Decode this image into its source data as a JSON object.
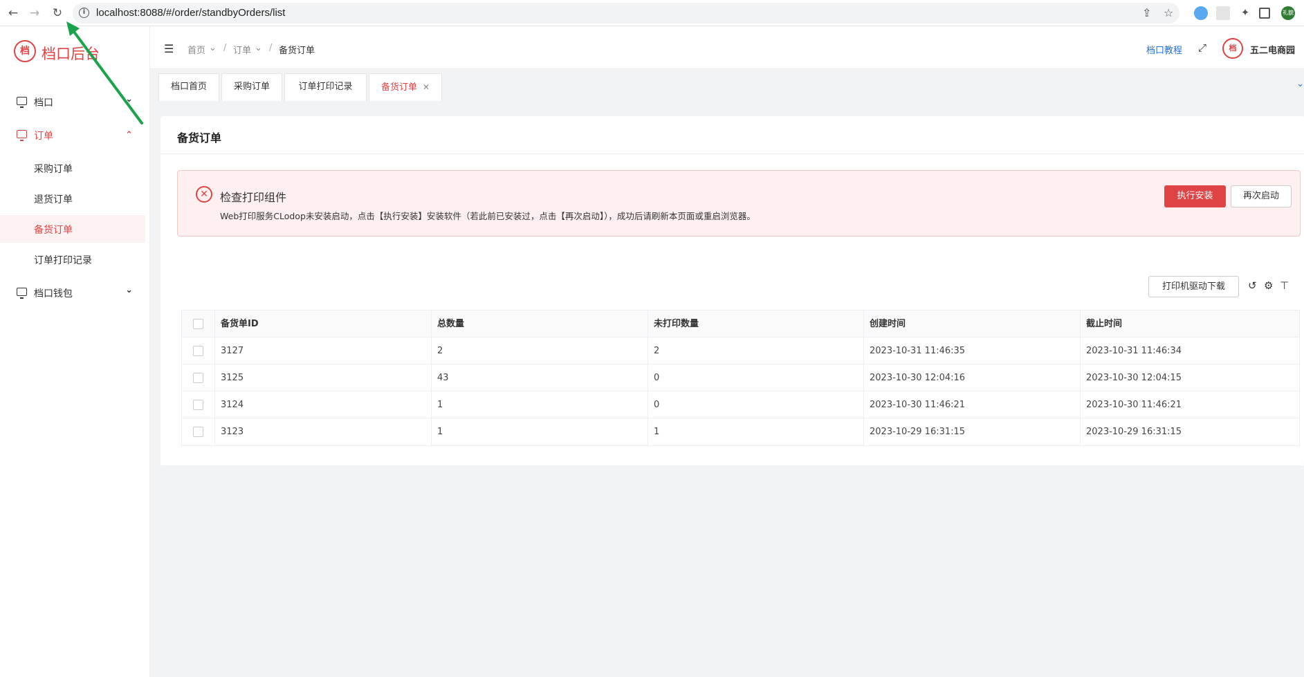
{
  "browser": {
    "url": "localhost:8088/#/order/standbyOrders/list",
    "profile_badge": "礼貌"
  },
  "sidebar": {
    "logo_text": "档口后台",
    "items": [
      {
        "label": "档口",
        "icon": "monitor-icon",
        "expanded": false
      },
      {
        "label": "订单",
        "icon": "monitor-icon",
        "expanded": true,
        "active": true
      },
      {
        "label": "档口钱包",
        "icon": "monitor-icon",
        "expanded": false
      }
    ],
    "sub_items": [
      {
        "label": "采购订单"
      },
      {
        "label": "退货订单"
      },
      {
        "label": "备货订单",
        "current": true
      },
      {
        "label": "订单打印记录"
      }
    ]
  },
  "header": {
    "breadcrumb": [
      "首页",
      "订单",
      "备货订单"
    ],
    "tutorial_link": "档口教程",
    "store_name": "五二电商园"
  },
  "tabs": [
    {
      "label": "档口首页"
    },
    {
      "label": "采购订单"
    },
    {
      "label": "订单打印记录"
    },
    {
      "label": "备货订单",
      "active": true,
      "closable": true
    }
  ],
  "page": {
    "title": "备货订单"
  },
  "alert": {
    "title": "检查打印组件",
    "description": "Web打印服务CLodop未安装启动，点击【执行安装】安装软件（若此前已安装过，点击【再次启动】），成功后请刷新本页面或重启浏览器。",
    "install_label": "执行安装",
    "restart_label": "再次启动"
  },
  "toolbar": {
    "driver_download_label": "打印机驱动下载"
  },
  "table": {
    "columns": [
      "备货单ID",
      "总数量",
      "未打印数量",
      "创建时间",
      "截止时间"
    ],
    "rows": [
      [
        "3127",
        "2",
        "2",
        "2023-10-31 11:46:35",
        "2023-10-31 11:46:34"
      ],
      [
        "3125",
        "43",
        "0",
        "2023-10-30 12:04:16",
        "2023-10-30 12:04:15"
      ],
      [
        "3124",
        "1",
        "0",
        "2023-10-30 11:46:21",
        "2023-10-30 11:46:21"
      ],
      [
        "3123",
        "1",
        "1",
        "2023-10-29 16:31:15",
        "2023-10-29 16:31:15"
      ]
    ]
  },
  "colors": {
    "accent": "#e04343",
    "link": "#1f6fd6",
    "annotation_arrow": "#1aa34a"
  }
}
